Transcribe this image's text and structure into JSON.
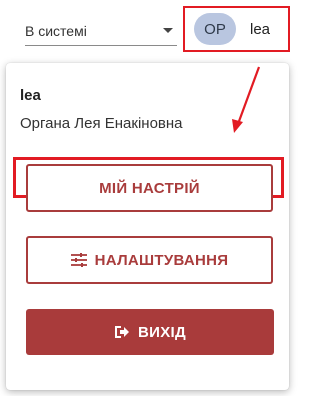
{
  "header": {
    "status_select": {
      "value": "В системі"
    },
    "user_chip": {
      "initials": "OP",
      "username": "lea"
    }
  },
  "user_menu": {
    "login": "lea",
    "full_name": "Органа Лея Енакіновна",
    "buttons": {
      "my_mood": "МІЙ НАСТРІЙ",
      "settings": "НАЛАШТУВАННЯ",
      "exit": "ВИХІД"
    }
  },
  "colors": {
    "accent": "#a93c3c",
    "annotation": "#e21b23",
    "avatar_bg": "#b9c6e0"
  },
  "icons": {
    "select_caret": "caret-down-icon",
    "settings": "sliders-icon",
    "exit": "exit-door-icon"
  }
}
